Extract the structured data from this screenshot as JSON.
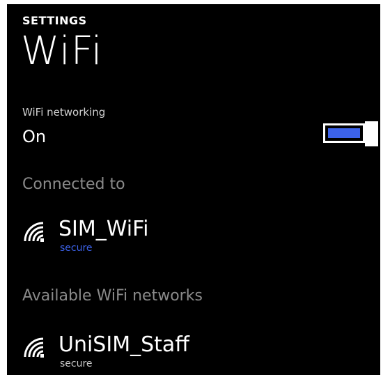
{
  "header": {
    "section_label": "SETTINGS",
    "title": "WiFi"
  },
  "wifi_toggle": {
    "caption": "WiFi networking",
    "state_label": "On",
    "on": true,
    "accent_color": "#3c62ea"
  },
  "connected": {
    "header": "Connected to",
    "network": {
      "name": "SIM_WiFi",
      "status": "secure",
      "status_color": "#3c62ea",
      "icon": "wifi-signal-icon"
    }
  },
  "available": {
    "header": "Available WiFi networks",
    "networks": [
      {
        "name": "UniSIM_Staff",
        "status": "secure",
        "status_color": "#c8c8c8",
        "icon": "wifi-signal-icon"
      }
    ]
  }
}
